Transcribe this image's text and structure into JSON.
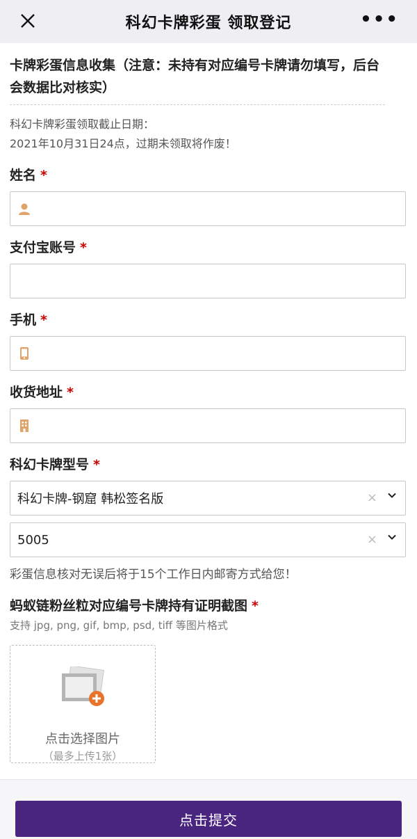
{
  "header": {
    "title": "科幻卡牌彩蛋 领取登记",
    "more": "•••"
  },
  "form": {
    "section_title": "卡牌彩蛋信息收集（注意：未持有对应编号卡牌请勿填写，后台会数据比对核实）",
    "notice_line1": "科幻卡牌彩蛋领取截止日期：",
    "notice_line2": "2021年10月31日24点，过期未领取将作废！",
    "required_mark": "*",
    "fields": {
      "name": {
        "label": "姓名",
        "icon": "user-icon",
        "value": ""
      },
      "alipay": {
        "label": "支付宝账号",
        "value": ""
      },
      "phone": {
        "label": "手机",
        "icon": "phone-icon",
        "value": ""
      },
      "address": {
        "label": "收货地址",
        "icon": "building-icon",
        "value": ""
      },
      "model": {
        "label": "科幻卡牌型号",
        "select1_value": "科幻卡牌-钢窟 韩松签名版",
        "select2_value": "5005",
        "clear": "×"
      }
    },
    "mail_hint": "彩蛋信息核对无误后将于15个工作日内邮寄方式给您！",
    "proof": {
      "label": "蚂蚁链粉丝粒对应编号卡牌持有证明截图",
      "formats": "支持 jpg, png, gif, bmp, psd, tiff 等图片格式",
      "upload_text": "点击选择图片",
      "upload_sub": "（最多上传1张）"
    },
    "submit_label": "点击提交"
  },
  "colors": {
    "accent": "#4a2580",
    "required": "#cc0000",
    "icon": "#e0a36a",
    "plus": "#e8742a"
  }
}
